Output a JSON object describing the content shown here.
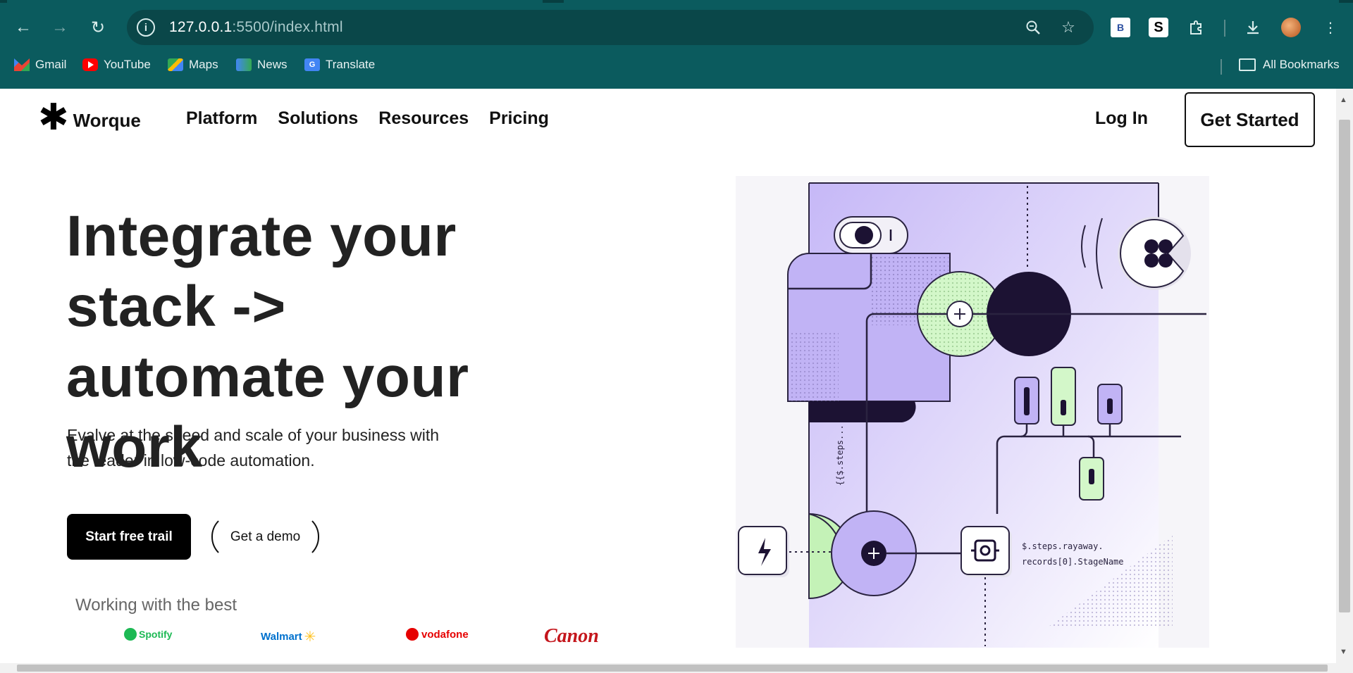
{
  "browser": {
    "url_host": "127.0.0.1",
    "url_rest": ":5500/index.html",
    "bookmarks": [
      {
        "label": "Gmail",
        "icon": "gmail-icon"
      },
      {
        "label": "YouTube",
        "icon": "youtube-icon"
      },
      {
        "label": "Maps",
        "icon": "maps-icon"
      },
      {
        "label": "News",
        "icon": "news-icon"
      },
      {
        "label": "Translate",
        "icon": "translate-icon"
      }
    ],
    "all_bookmarks": "All Bookmarks",
    "ext_b": "B",
    "ext_s": "S"
  },
  "site": {
    "logo": "Worque",
    "nav": [
      "Platform",
      "Solutions",
      "Resources",
      "Pricing"
    ],
    "login": "Log In",
    "get_started": "Get Started"
  },
  "hero": {
    "title": "Integrate your stack -> automate your work",
    "subtitle": "Evalve at the speed and scale of your business with the leader in low-code automation.",
    "primary_cta": "Start free trail",
    "secondary_cta": "Get a demo",
    "working_with": "Working with the best",
    "brands": [
      "Spotify",
      "Walmart",
      "vodafone",
      "Canon"
    ]
  },
  "illustration": {
    "code_label": "{{$.steps...",
    "code_line1": "$.steps.rayaway.",
    "code_line2": "records[0].StageName"
  },
  "colors": {
    "chrome": "#0b5b5e",
    "lavender": "#c9bdf7",
    "mint": "#d3f7c9",
    "dark": "#1c1233"
  }
}
